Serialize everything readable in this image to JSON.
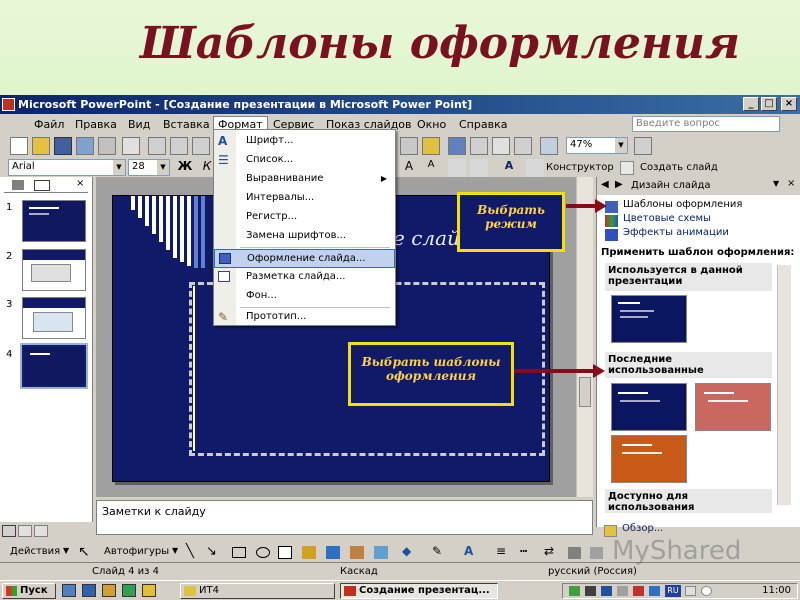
{
  "slide_heading": "Шаблоны оформления",
  "window": {
    "title": "Microsoft PowerPoint - [Создание презентации в Microsoft Power Point]",
    "buttons": [
      "_",
      "□",
      "×"
    ]
  },
  "menubar": {
    "items": [
      "Файл",
      "Правка",
      "Вид",
      "Вставка",
      "Формат",
      "Сервис",
      "Показ слайдов",
      "Окно",
      "Справка"
    ],
    "search_placeholder": "Введите вопрос"
  },
  "toolbar": {
    "zoom": "47%",
    "font": "Arial",
    "size": "28",
    "designer_label": "Конструктор",
    "new_slide_label": "Создать слайд"
  },
  "format_menu": {
    "items": [
      {
        "label": "Шрифт...",
        "icon": "font-icon"
      },
      {
        "label": "Список...",
        "icon": "list-icon"
      },
      {
        "label": "Выравнивание",
        "icon": "",
        "submenu": true
      },
      {
        "label": "Интервалы...",
        "icon": ""
      },
      {
        "label": "Регистр...",
        "icon": ""
      },
      {
        "label": "Замена шрифтов...",
        "icon": ""
      },
      {
        "label": "Оформление слайда...",
        "icon": "slide-design-icon",
        "highlighted": true
      },
      {
        "label": "Разметка слайда...",
        "icon": "slide-layout-icon"
      },
      {
        "label": "Фон...",
        "icon": ""
      },
      {
        "label": "Прототип...",
        "icon": "prototype-icon"
      }
    ]
  },
  "slides_pane": {
    "numbers": [
      "1",
      "2",
      "3",
      "4"
    ],
    "selected": 4
  },
  "slide": {
    "ghost_text": "е слайда"
  },
  "task_pane": {
    "title": "Дизайн слайда",
    "links": [
      "Шаблоны оформления",
      "Цветовые схемы",
      "Эффекты анимации"
    ],
    "apply_label": "Применить шаблон оформления:",
    "sections": [
      "Используется в данной презентации",
      "Последние использованные",
      "Доступно для использования"
    ],
    "browse": "Обзор..."
  },
  "callouts": {
    "mode": [
      "Выбрать",
      "режим"
    ],
    "templates": [
      "Выбрать шаблоны",
      "оформления"
    ]
  },
  "notes": "Заметки к слайду",
  "drawbar": {
    "actions": "Действия",
    "autoshapes": "Автофигуры"
  },
  "status": {
    "slide": "Слайд 4 из 4",
    "design": "Каскад",
    "lang": "русский (Россия)"
  },
  "taskbar": {
    "start": "Пуск",
    "items": [
      "ИТ4",
      "Создание презентац..."
    ],
    "clock": "11:00"
  },
  "watermark": "MyShared"
}
